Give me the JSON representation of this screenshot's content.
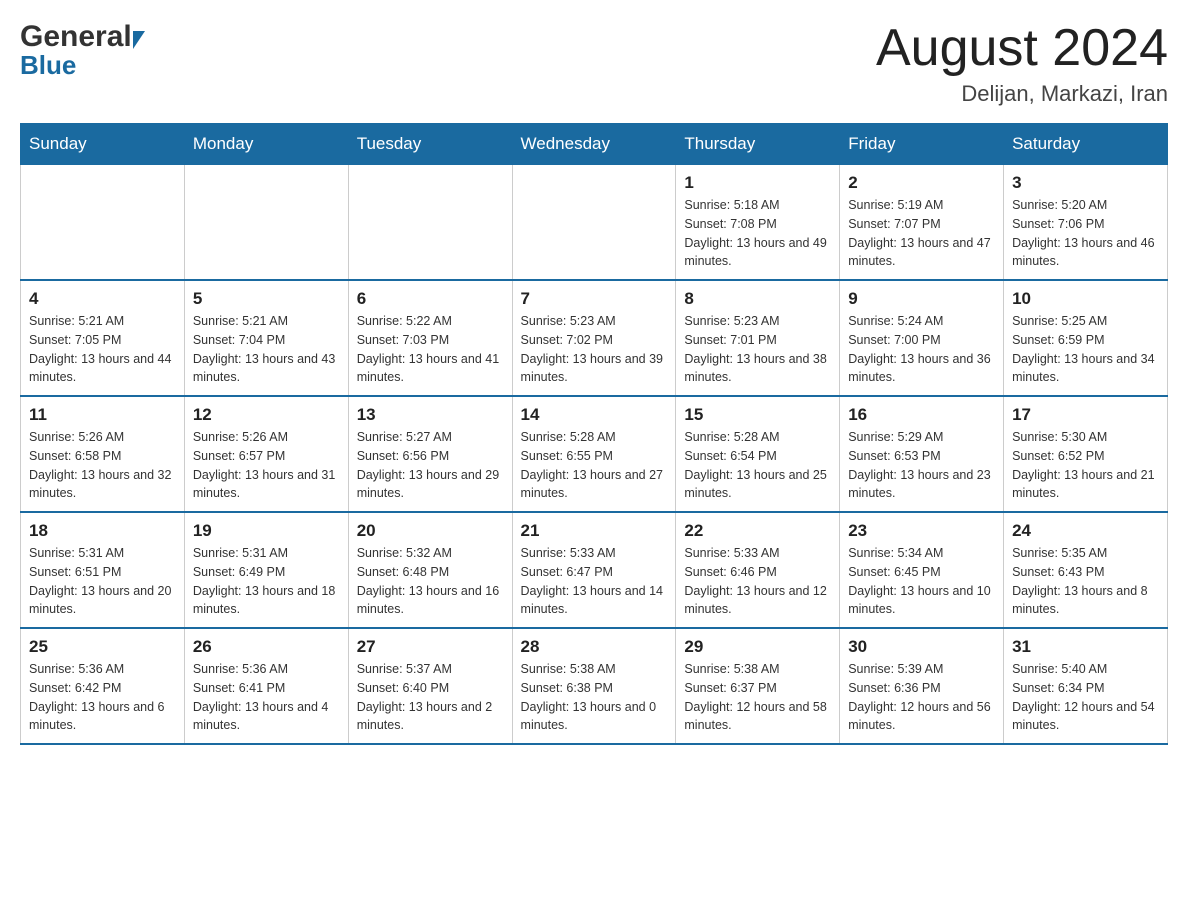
{
  "header": {
    "logo_general": "General",
    "logo_blue": "Blue",
    "month_title": "August 2024",
    "location": "Delijan, Markazi, Iran"
  },
  "days_of_week": [
    "Sunday",
    "Monday",
    "Tuesday",
    "Wednesday",
    "Thursday",
    "Friday",
    "Saturday"
  ],
  "weeks": [
    [
      {
        "day": "",
        "info": ""
      },
      {
        "day": "",
        "info": ""
      },
      {
        "day": "",
        "info": ""
      },
      {
        "day": "",
        "info": ""
      },
      {
        "day": "1",
        "info": "Sunrise: 5:18 AM\nSunset: 7:08 PM\nDaylight: 13 hours and 49 minutes."
      },
      {
        "day": "2",
        "info": "Sunrise: 5:19 AM\nSunset: 7:07 PM\nDaylight: 13 hours and 47 minutes."
      },
      {
        "day": "3",
        "info": "Sunrise: 5:20 AM\nSunset: 7:06 PM\nDaylight: 13 hours and 46 minutes."
      }
    ],
    [
      {
        "day": "4",
        "info": "Sunrise: 5:21 AM\nSunset: 7:05 PM\nDaylight: 13 hours and 44 minutes."
      },
      {
        "day": "5",
        "info": "Sunrise: 5:21 AM\nSunset: 7:04 PM\nDaylight: 13 hours and 43 minutes."
      },
      {
        "day": "6",
        "info": "Sunrise: 5:22 AM\nSunset: 7:03 PM\nDaylight: 13 hours and 41 minutes."
      },
      {
        "day": "7",
        "info": "Sunrise: 5:23 AM\nSunset: 7:02 PM\nDaylight: 13 hours and 39 minutes."
      },
      {
        "day": "8",
        "info": "Sunrise: 5:23 AM\nSunset: 7:01 PM\nDaylight: 13 hours and 38 minutes."
      },
      {
        "day": "9",
        "info": "Sunrise: 5:24 AM\nSunset: 7:00 PM\nDaylight: 13 hours and 36 minutes."
      },
      {
        "day": "10",
        "info": "Sunrise: 5:25 AM\nSunset: 6:59 PM\nDaylight: 13 hours and 34 minutes."
      }
    ],
    [
      {
        "day": "11",
        "info": "Sunrise: 5:26 AM\nSunset: 6:58 PM\nDaylight: 13 hours and 32 minutes."
      },
      {
        "day": "12",
        "info": "Sunrise: 5:26 AM\nSunset: 6:57 PM\nDaylight: 13 hours and 31 minutes."
      },
      {
        "day": "13",
        "info": "Sunrise: 5:27 AM\nSunset: 6:56 PM\nDaylight: 13 hours and 29 minutes."
      },
      {
        "day": "14",
        "info": "Sunrise: 5:28 AM\nSunset: 6:55 PM\nDaylight: 13 hours and 27 minutes."
      },
      {
        "day": "15",
        "info": "Sunrise: 5:28 AM\nSunset: 6:54 PM\nDaylight: 13 hours and 25 minutes."
      },
      {
        "day": "16",
        "info": "Sunrise: 5:29 AM\nSunset: 6:53 PM\nDaylight: 13 hours and 23 minutes."
      },
      {
        "day": "17",
        "info": "Sunrise: 5:30 AM\nSunset: 6:52 PM\nDaylight: 13 hours and 21 minutes."
      }
    ],
    [
      {
        "day": "18",
        "info": "Sunrise: 5:31 AM\nSunset: 6:51 PM\nDaylight: 13 hours and 20 minutes."
      },
      {
        "day": "19",
        "info": "Sunrise: 5:31 AM\nSunset: 6:49 PM\nDaylight: 13 hours and 18 minutes."
      },
      {
        "day": "20",
        "info": "Sunrise: 5:32 AM\nSunset: 6:48 PM\nDaylight: 13 hours and 16 minutes."
      },
      {
        "day": "21",
        "info": "Sunrise: 5:33 AM\nSunset: 6:47 PM\nDaylight: 13 hours and 14 minutes."
      },
      {
        "day": "22",
        "info": "Sunrise: 5:33 AM\nSunset: 6:46 PM\nDaylight: 13 hours and 12 minutes."
      },
      {
        "day": "23",
        "info": "Sunrise: 5:34 AM\nSunset: 6:45 PM\nDaylight: 13 hours and 10 minutes."
      },
      {
        "day": "24",
        "info": "Sunrise: 5:35 AM\nSunset: 6:43 PM\nDaylight: 13 hours and 8 minutes."
      }
    ],
    [
      {
        "day": "25",
        "info": "Sunrise: 5:36 AM\nSunset: 6:42 PM\nDaylight: 13 hours and 6 minutes."
      },
      {
        "day": "26",
        "info": "Sunrise: 5:36 AM\nSunset: 6:41 PM\nDaylight: 13 hours and 4 minutes."
      },
      {
        "day": "27",
        "info": "Sunrise: 5:37 AM\nSunset: 6:40 PM\nDaylight: 13 hours and 2 minutes."
      },
      {
        "day": "28",
        "info": "Sunrise: 5:38 AM\nSunset: 6:38 PM\nDaylight: 13 hours and 0 minutes."
      },
      {
        "day": "29",
        "info": "Sunrise: 5:38 AM\nSunset: 6:37 PM\nDaylight: 12 hours and 58 minutes."
      },
      {
        "day": "30",
        "info": "Sunrise: 5:39 AM\nSunset: 6:36 PM\nDaylight: 12 hours and 56 minutes."
      },
      {
        "day": "31",
        "info": "Sunrise: 5:40 AM\nSunset: 6:34 PM\nDaylight: 12 hours and 54 minutes."
      }
    ]
  ]
}
